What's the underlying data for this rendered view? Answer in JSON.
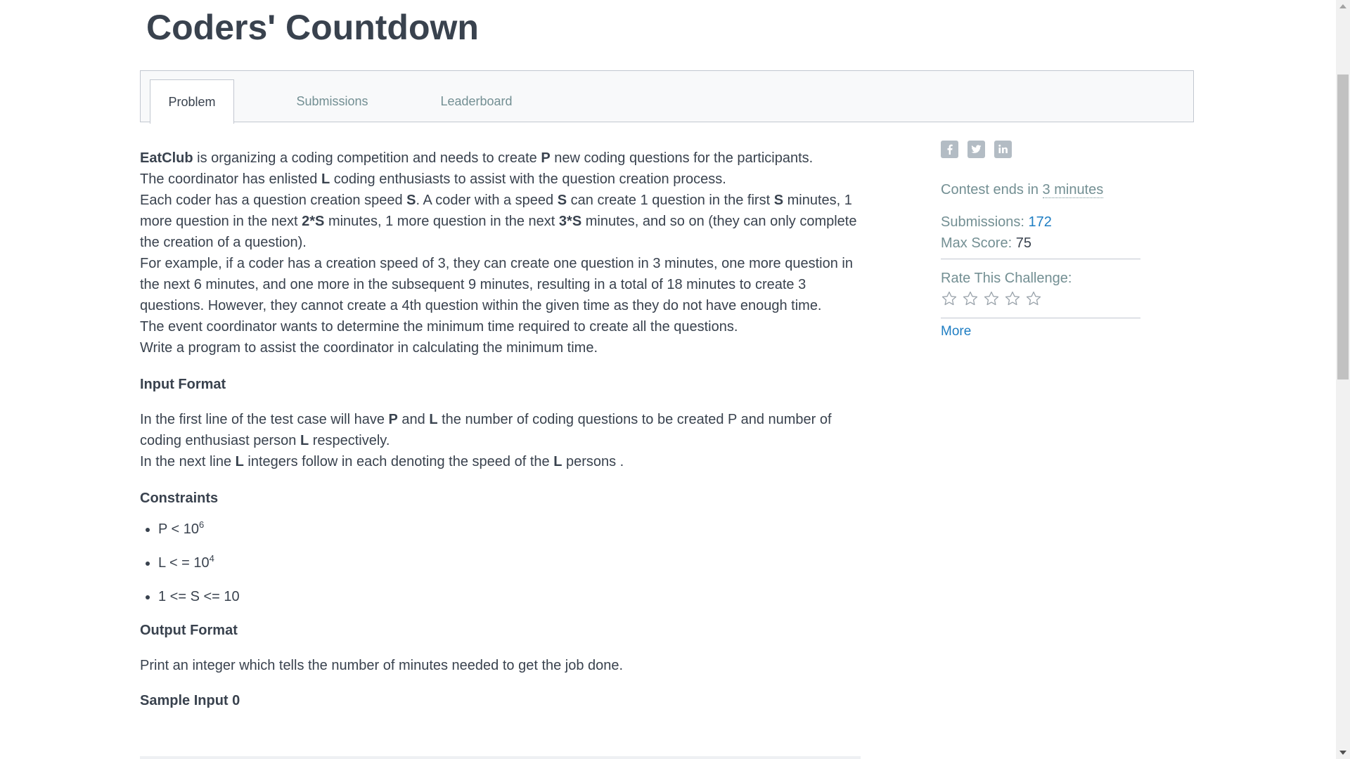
{
  "page": {
    "title": "Coders' Countdown"
  },
  "tabs": [
    {
      "label": "Problem",
      "active": true
    },
    {
      "label": "Submissions",
      "active": false
    },
    {
      "label": "Leaderboard",
      "active": false
    }
  ],
  "problem": {
    "intro": {
      "brand": "EatClub",
      "l1_a": " is organizing a coding competition and needs to create ",
      "var_p": "P",
      "l1_b": " new coding questions for the participants.",
      "l2_a": "The coordinator has enlisted ",
      "var_l": "L",
      "l2_b": " coding enthusiasts to assist with the question creation process.",
      "l3_a": "Each coder has a question creation speed ",
      "var_s": "S",
      "l3_b": ". A coder with a speed ",
      "l3_c": " can create 1 question in the first ",
      "l3_d": " minutes, 1 more question in the next ",
      "var_2s": "2*S",
      "l3_e": " minutes, 1 more question in the next ",
      "var_3s": "3*S",
      "l3_f": " minutes, and so on (they can only complete the creation of a question).",
      "example": "For example, if a coder has a creation speed of 3, they can create one question in 3 minutes, one more question in the next 6 minutes, and one more in the subsequent 9 minutes, resulting in a total of 18 minutes to create 3 questions. However, they cannot create a 4th question within the given time as they do not have enough time.",
      "goal": "The event coordinator wants to determine the minimum time required to create all the questions.",
      "task": "Write a program to assist the coordinator in calculating the minimum time."
    },
    "input_format": {
      "heading": "Input Format",
      "l1_a": "In the first line of the test case will have ",
      "var_p": "P",
      "l1_b": " and ",
      "var_l": "L",
      "l1_c": " the number of coding questions to be created P and number of coding enthusiast person ",
      "l1_d": " respectively.",
      "l2_a": "In the next line ",
      "l2_b": " integers follow in each denoting the speed of the ",
      "l2_c": " persons ."
    },
    "constraints": {
      "heading": "Constraints",
      "items": [
        {
          "text": "P < 10",
          "sup": "6"
        },
        {
          "text": "L < = 10",
          "sup": "4"
        },
        {
          "text": "1 <= S <= 10",
          "sup": ""
        }
      ]
    },
    "output_format": {
      "heading": "Output Format",
      "text": "Print an integer which tells the number of minutes needed to get the job done."
    },
    "sample_input": {
      "heading": "Sample Input 0"
    }
  },
  "sidebar": {
    "share_icons": [
      "facebook-icon",
      "twitter-icon",
      "linkedin-icon"
    ],
    "contest_prefix": "Contest ends in ",
    "contest_value": "3 minutes",
    "submissions_label": "Submissions: ",
    "submissions_value": "172",
    "max_score_label": "Max Score: ",
    "max_score_value": "75",
    "rate_label": "Rate This Challenge:",
    "stars": 5,
    "more_label": "More"
  },
  "colors": {
    "text": "#39424e",
    "muted": "#738f93",
    "link": "#1f7ec3",
    "border": "#c2c7d0"
  }
}
